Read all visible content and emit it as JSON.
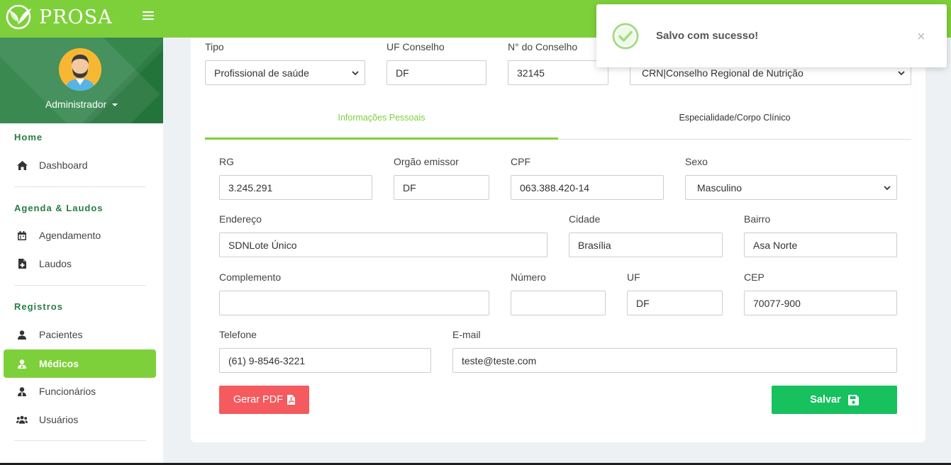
{
  "app": {
    "name": "PROSA"
  },
  "sidebar": {
    "user": "Administrador",
    "sections": [
      {
        "title": "Home",
        "items": [
          {
            "label": "Dashboard",
            "icon": "home-icon"
          }
        ]
      },
      {
        "title": "Agenda & Laudos",
        "items": [
          {
            "label": "Agendamento",
            "icon": "calendar-icon"
          },
          {
            "label": "Laudos",
            "icon": "file-medical-icon"
          }
        ]
      },
      {
        "title": "Registros",
        "items": [
          {
            "label": "Pacientes",
            "icon": "user-icon"
          },
          {
            "label": "Médicos",
            "icon": "user-doctor-icon",
            "active": true
          },
          {
            "label": "Funcionários",
            "icon": "user-tie-icon"
          },
          {
            "label": "Usuários",
            "icon": "users-icon"
          }
        ]
      }
    ]
  },
  "form": {
    "top": {
      "tipo_label": "Tipo",
      "tipo_value": "Profissional de saúde",
      "uf_conselho_label": "UF Conselho",
      "uf_conselho_value": "DF",
      "num_conselho_label": "N° do Conselho",
      "num_conselho_value": "32145",
      "conselho_value": "CRN|Conselho Regional de Nutrição"
    },
    "tabs": [
      {
        "label": "Informações Pessoais",
        "active": true
      },
      {
        "label": "Especialidade/Corpo Clínico",
        "active": false
      }
    ],
    "fields": {
      "rg": {
        "label": "RG",
        "value": "3.245.291"
      },
      "orgao": {
        "label": "Orgão emissor",
        "value": "DF"
      },
      "cpf": {
        "label": "CPF",
        "value": "063.388.420-14"
      },
      "sexo": {
        "label": "Sexo",
        "value": "Masculino"
      },
      "endereco": {
        "label": "Endereço",
        "value": "SDNLote Único"
      },
      "cidade": {
        "label": "Cidade",
        "value": "Brasília"
      },
      "bairro": {
        "label": "Bairro",
        "value": "Asa Norte"
      },
      "complemento": {
        "label": "Complemento",
        "value": ""
      },
      "numero": {
        "label": "Número",
        "value": ""
      },
      "uf": {
        "label": "UF",
        "value": "DF"
      },
      "cep": {
        "label": "CEP",
        "value": "70077-900"
      },
      "telefone": {
        "label": "Telefone",
        "value": "(61) 9-8546-3221"
      },
      "email": {
        "label": "E-mail",
        "value": "teste@teste.com"
      }
    },
    "buttons": {
      "pdf": "Gerar PDF",
      "save": "Salvar"
    }
  },
  "toast": {
    "message": "Salvo com sucesso!",
    "close": "×"
  },
  "colors": {
    "accent": "#7ed03a",
    "sidebar_dark": "#267e40",
    "danger": "#f55a5e",
    "success": "#16c15e"
  }
}
